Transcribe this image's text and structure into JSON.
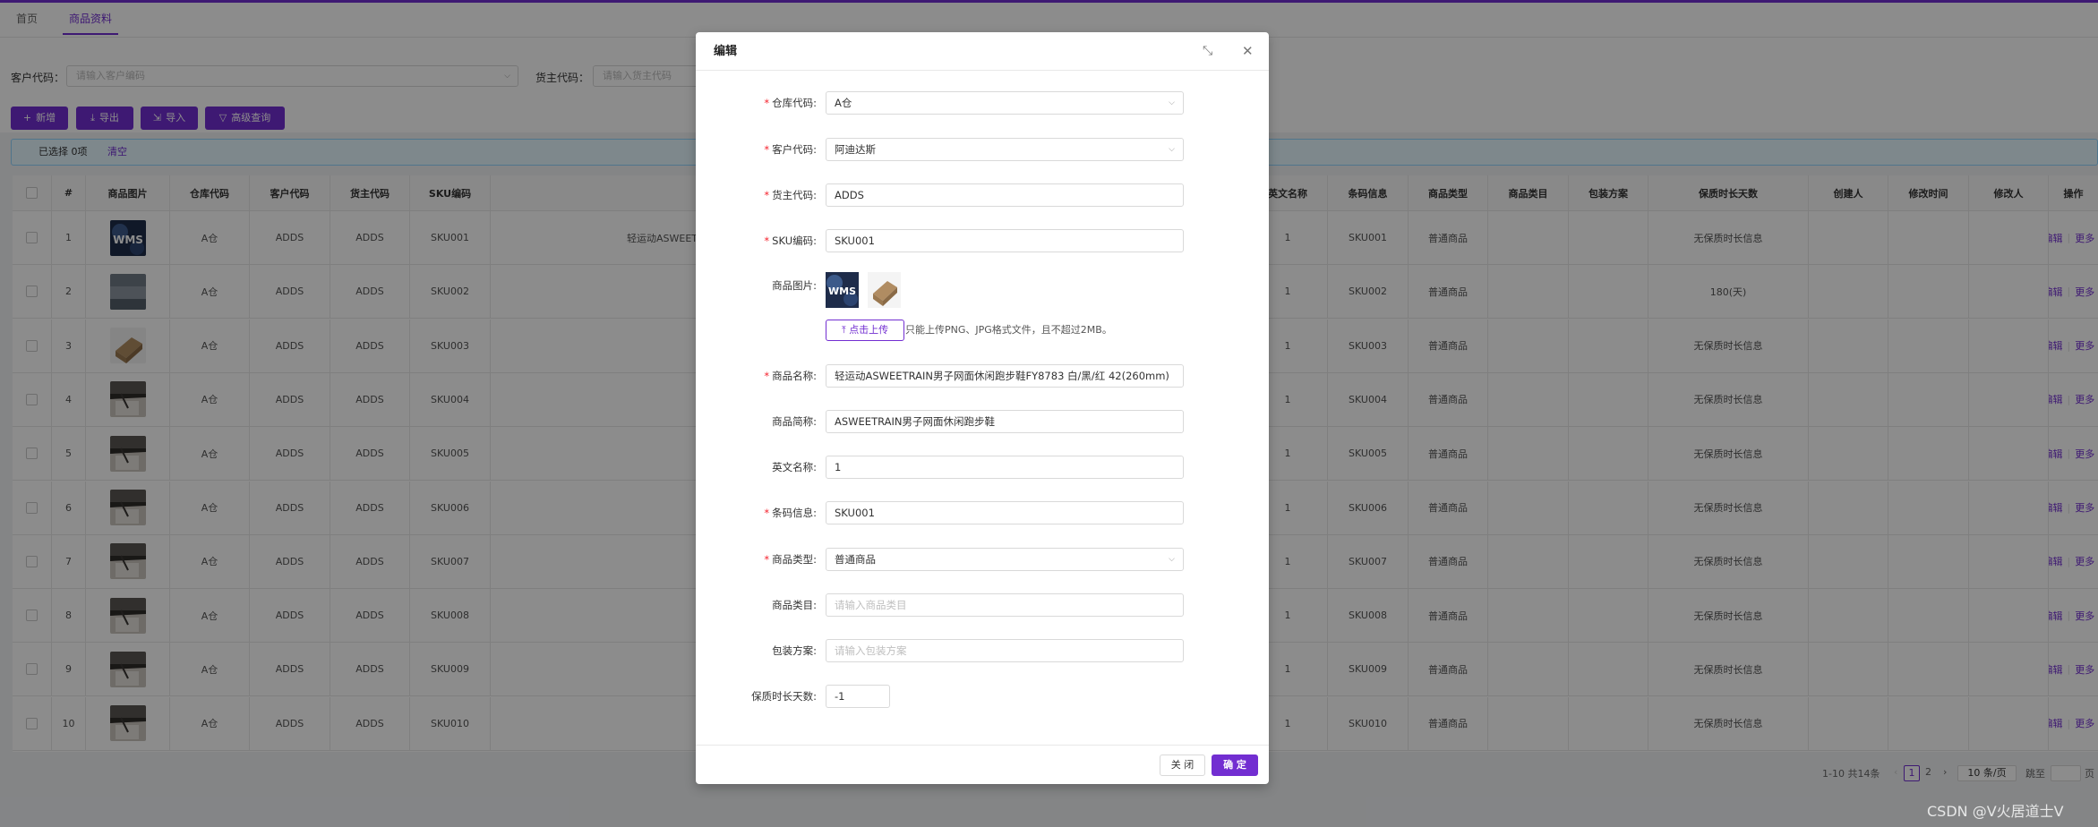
{
  "tabs": [
    {
      "label": "首页"
    },
    {
      "label": "商品资料"
    }
  ],
  "search": {
    "customer_label": "客户代码：",
    "customer_placeholder": "请输入客户编码",
    "owner_label": "货主代码：",
    "owner_placeholder": "请输入货主代码"
  },
  "toolbar": {
    "add": {
      "icon": "plus-icon",
      "glyph": "+",
      "label": "新增"
    },
    "export": {
      "icon": "download-icon",
      "glyph": "⤓",
      "label": "导出"
    },
    "import": {
      "icon": "import-icon",
      "glyph": "⇲",
      "label": "导入"
    },
    "advanced": {
      "icon": "filter-icon",
      "glyph": "▽",
      "label": "高级查询"
    }
  },
  "selection": {
    "text": "已选择 0项",
    "clear": "清空"
  },
  "table": {
    "columns": [
      "#",
      "商品图片",
      "仓库代码",
      "客户代码",
      "货主代码",
      "SKU编码",
      "英文名称",
      "条码信息",
      "商品类型",
      "商品类目",
      "包装方案",
      "保质时长天数",
      "创建人",
      "修改时间",
      "修改人",
      "操作"
    ],
    "rows": [
      {
        "no": "1",
        "img": "wms",
        "wh": "A仓",
        "cust": "ADDS",
        "owner": "ADDS",
        "sku": "SKU001",
        "name": "轻运动ASWEETRAIN男",
        "en": "1",
        "barcode": "SKU001",
        "type": "普通商品",
        "shelf": "无保质时长信息"
      },
      {
        "no": "2",
        "img": "fog",
        "wh": "A仓",
        "cust": "ADDS",
        "owner": "ADDS",
        "sku": "SKU002",
        "name": "",
        "en": "1",
        "barcode": "SKU002",
        "type": "普通商品",
        "shelf": "180(天)"
      },
      {
        "no": "3",
        "img": "box",
        "wh": "A仓",
        "cust": "ADDS",
        "owner": "ADDS",
        "sku": "SKU003",
        "name": "",
        "en": "1",
        "barcode": "SKU003",
        "type": "普通商品",
        "shelf": "无保质时长信息"
      },
      {
        "no": "4",
        "img": "wall",
        "wh": "A仓",
        "cust": "ADDS",
        "owner": "ADDS",
        "sku": "SKU004",
        "name": "",
        "en": "1",
        "barcode": "SKU004",
        "type": "普通商品",
        "shelf": "无保质时长信息"
      },
      {
        "no": "5",
        "img": "wall",
        "wh": "A仓",
        "cust": "ADDS",
        "owner": "ADDS",
        "sku": "SKU005",
        "name": "",
        "en": "1",
        "barcode": "SKU005",
        "type": "普通商品",
        "shelf": "无保质时长信息"
      },
      {
        "no": "6",
        "img": "wall",
        "wh": "A仓",
        "cust": "ADDS",
        "owner": "ADDS",
        "sku": "SKU006",
        "name": "",
        "en": "1",
        "barcode": "SKU006",
        "type": "普通商品",
        "shelf": "无保质时长信息"
      },
      {
        "no": "7",
        "img": "wall",
        "wh": "A仓",
        "cust": "ADDS",
        "owner": "ADDS",
        "sku": "SKU007",
        "name": "",
        "en": "1",
        "barcode": "SKU007",
        "type": "普通商品",
        "shelf": "无保质时长信息"
      },
      {
        "no": "8",
        "img": "wall",
        "wh": "A仓",
        "cust": "ADDS",
        "owner": "ADDS",
        "sku": "SKU008",
        "name": "",
        "en": "1",
        "barcode": "SKU008",
        "type": "普通商品",
        "shelf": "无保质时长信息"
      },
      {
        "no": "9",
        "img": "wall",
        "wh": "A仓",
        "cust": "ADDS",
        "owner": "ADDS",
        "sku": "SKU009",
        "name": "",
        "en": "1",
        "barcode": "SKU009",
        "type": "普通商品",
        "shelf": "无保质时长信息"
      },
      {
        "no": "10",
        "img": "wall",
        "wh": "A仓",
        "cust": "ADDS",
        "owner": "ADDS",
        "sku": "SKU010",
        "name": "",
        "en": "1",
        "barcode": "SKU010",
        "type": "普通商品",
        "shelf": "无保质时长信息"
      }
    ],
    "action_edit": "编辑",
    "action_more": "更多"
  },
  "pagination": {
    "summary": "1-10 共14条",
    "pages": [
      "1",
      "2"
    ],
    "current": "1",
    "size": "10 条/页",
    "jump_label": "跳至",
    "jump_suffix": "页"
  },
  "modal": {
    "title": "编辑",
    "fields": {
      "warehouse": {
        "label": "仓库代码:",
        "value": "A仓",
        "required": true
      },
      "customer": {
        "label": "客户代码:",
        "value": "阿迪达斯",
        "required": true
      },
      "owner": {
        "label": "货主代码:",
        "value": "ADDS",
        "required": true
      },
      "sku": {
        "label": "SKU编码:",
        "value": "SKU001",
        "required": true
      },
      "image": {
        "label": "商品图片:",
        "upload_label": "点击上传",
        "tip": "只能上传PNG、JPG格式文件，且不超过2MB。"
      },
      "name": {
        "label": "商品名称:",
        "value": "轻运动ASWEETRAIN男子网面休闲跑步鞋FY8783 白/黑/红 42(260mm)",
        "required": true
      },
      "short": {
        "label": "商品简称:",
        "value": "ASWEETRAIN男子网面休闲跑步鞋"
      },
      "english": {
        "label": "英文名称:",
        "value": "1"
      },
      "barcode": {
        "label": "条码信息:",
        "value": "SKU001",
        "required": true
      },
      "type": {
        "label": "商品类型:",
        "value": "普通商品",
        "required": true
      },
      "category": {
        "label": "商品类目:",
        "placeholder": "请输入商品类目"
      },
      "package": {
        "label": "包装方案:",
        "placeholder": "请输入包装方案"
      },
      "shelf": {
        "label": "保质时长天数:",
        "value": "-1"
      }
    },
    "close": "关 闭",
    "ok": "确 定"
  },
  "watermark": "CSDN @V火居道士V",
  "colors": {
    "accent": "#722ed1",
    "required": "#f5222d"
  }
}
